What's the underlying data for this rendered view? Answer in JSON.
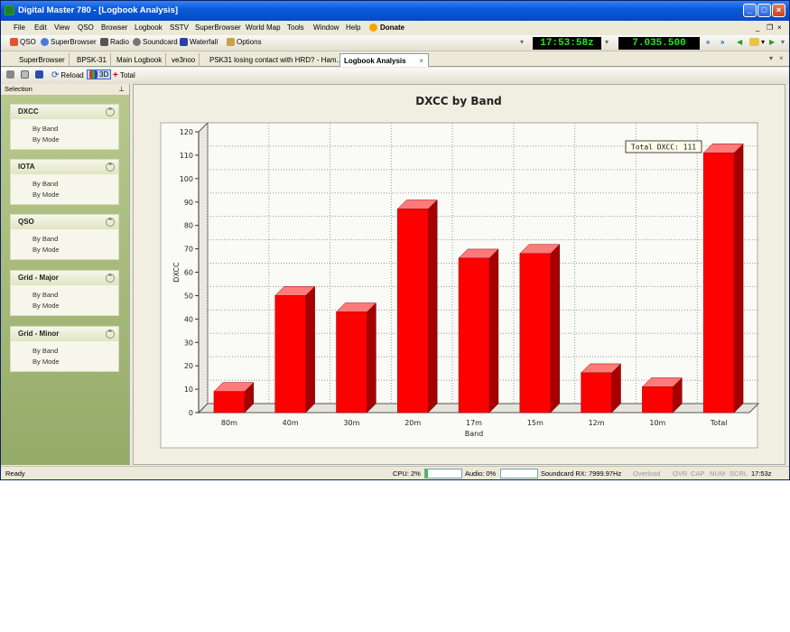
{
  "window": {
    "title": "Digital Master 780 - [Logbook Analysis]"
  },
  "menu": [
    "File",
    "Edit",
    "View",
    "QSO",
    "Browser",
    "Logbook",
    "SSTV",
    "SuperBrowser",
    "World Map",
    "Tools",
    "Window",
    "Help"
  ],
  "donate_label": "Donate",
  "toolbar": {
    "qso": "QSO",
    "superbrowser": "SuperBrowser",
    "radio": "Radio",
    "soundcard": "Soundcard",
    "waterfall": "Waterfall",
    "options": "Options",
    "time": "17:53:58z",
    "frequency": "7.035.500"
  },
  "tabs": [
    "SuperBrowser",
    "BPSK-31",
    "Main Logbook",
    "ve3noo",
    "PSK31 losing contact with HRD? - Ham...",
    "Logbook Analysis"
  ],
  "subtoolbar": {
    "reload": "Reload",
    "threed": "3D",
    "total": "Total"
  },
  "sidebar": {
    "header": "Selection",
    "panels": [
      {
        "title": "DXCC",
        "links": [
          "By Band",
          "By Mode"
        ]
      },
      {
        "title": "IOTA",
        "links": [
          "By Band",
          "By Mode"
        ]
      },
      {
        "title": "QSO",
        "links": [
          "By Band",
          "By Mode"
        ]
      },
      {
        "title": "Grid - Major",
        "links": [
          "By Band",
          "By Mode"
        ]
      },
      {
        "title": "Grid - Minor",
        "links": [
          "By Band",
          "By Mode"
        ]
      }
    ]
  },
  "status": {
    "ready": "Ready",
    "cpu": "CPU: 2%",
    "audio": "Audio: 0%",
    "soundcard_rx": "Soundcard RX: 7999.97Hz",
    "overload": "Overload",
    "ovr": "OVR",
    "cap": "CAP",
    "num": "NUM",
    "scrl": "SCRL",
    "time": "17:53z"
  },
  "colors": {
    "bar_front": "#ff0000",
    "bar_side": "#a50000",
    "bar_top": "#ff7a7a",
    "accent_display": "#22e822"
  },
  "chart_data": {
    "type": "bar",
    "title": "DXCC by Band",
    "xlabel": "Band",
    "ylabel": "DXCC",
    "categories": [
      "80m",
      "40m",
      "30m",
      "20m",
      "17m",
      "15m",
      "12m",
      "10m",
      "Total"
    ],
    "values": [
      9,
      50,
      43,
      87,
      66,
      68,
      17,
      11,
      111
    ],
    "ylim": [
      0,
      120
    ],
    "yticks": [
      0,
      10,
      20,
      30,
      40,
      50,
      60,
      70,
      80,
      90,
      100,
      110,
      120
    ],
    "annotation": "Total DXCC: 111",
    "grid": true,
    "style": "3d"
  }
}
